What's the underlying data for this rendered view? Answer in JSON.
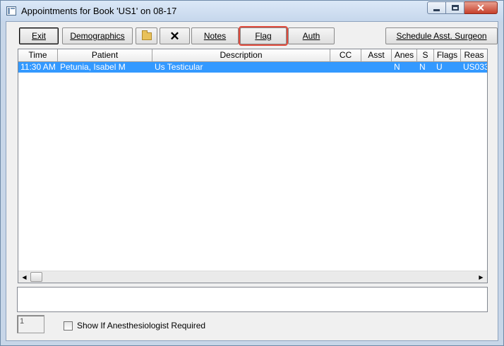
{
  "window": {
    "title": "Appointments for Book 'US1' on 08-17",
    "controls": {
      "minimize_icon": "minimize-icon",
      "maximize_icon": "maximize-icon",
      "close_icon": "close-icon",
      "close_glyph": "✕"
    }
  },
  "toolbar": {
    "exit_label": "Exit",
    "demographics_label": "Demographics",
    "folder_icon": "folder-icon",
    "delete_glyph": "✕",
    "notes_label": "Notes",
    "flag_label": "Flag",
    "auth_label": "Auth",
    "schedule_label": "Schedule Asst. Surgeon"
  },
  "grid": {
    "columns": [
      "Time",
      "Patient",
      "Description",
      "CC",
      "Asst",
      "Anes",
      "S",
      "Flags",
      "Reas"
    ],
    "rows": [
      {
        "time": "11:30 AM",
        "patient": "Petunia, Isabel M",
        "description": "Us Testicular",
        "cc": "",
        "asst": "",
        "anes": "N",
        "s": "N",
        "flags": "U",
        "reas": "US033"
      }
    ],
    "selected_row_color": "#3399ff"
  },
  "footer": {
    "count_value": "1",
    "checkbox_label": "Show If Anesthesiologist Required",
    "checkbox_checked": false
  },
  "colors": {
    "highlight_outline": "#e04a3c",
    "close_button": "#c7402b"
  }
}
